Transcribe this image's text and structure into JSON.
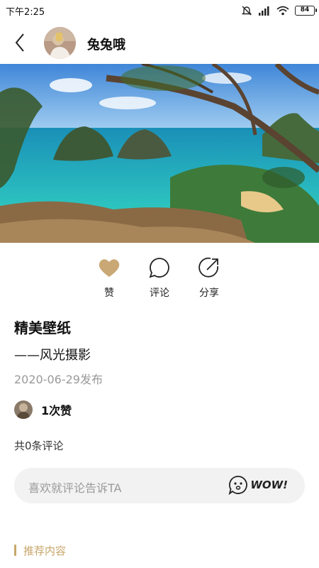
{
  "status": {
    "time": "下午2:25",
    "battery": "84"
  },
  "header": {
    "user_name": "兔兔哦"
  },
  "actions": {
    "like_label": "赞",
    "comment_label": "评论",
    "share_label": "分享"
  },
  "post": {
    "title": "精美壁纸",
    "subtitle": "——风光摄影",
    "date": "2020-06-29发布",
    "likes_text": "1次赞",
    "comment_count_text": "共0条评论"
  },
  "comment_input": {
    "placeholder": "喜欢就评论告诉TA",
    "wow_label": "WOW!"
  },
  "recommend": {
    "title": "推荐内容"
  },
  "colors": {
    "accent": "#c8a66a",
    "like_fill": "#c9a875",
    "input_bg": "#f2f2f2"
  },
  "icons": [
    "back-icon",
    "heart-icon",
    "comment-icon",
    "share-icon",
    "wow-face-icon",
    "signal-icon",
    "wifi-icon",
    "mute-icon",
    "battery-icon"
  ]
}
